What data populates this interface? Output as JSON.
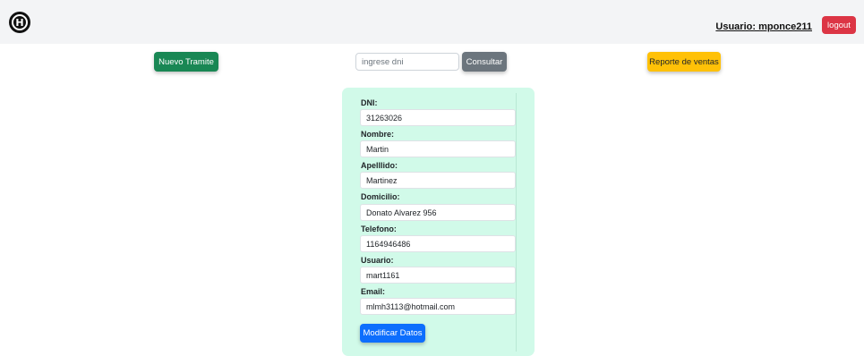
{
  "header": {
    "logo_letter": "H",
    "user_link": "Usuario: mponce211",
    "logout_label": "logout"
  },
  "toolbar": {
    "nuevo_tramite_label": "Nuevo Tramite",
    "search_placeholder": "ingrese dni",
    "search_value": "",
    "consultar_label": "Consultar",
    "reporte_label": "Reporte de ventas"
  },
  "form": {
    "fields": [
      {
        "label": "DNI:",
        "value": "31263026"
      },
      {
        "label": "Nombre:",
        "value": "Martin"
      },
      {
        "label": "Apelllido:",
        "value": "Martinez"
      },
      {
        "label": "Domicilio:",
        "value": "Donato Alvarez 956"
      },
      {
        "label": "Telefono:",
        "value": "1164946486"
      },
      {
        "label": "Usuario:",
        "value": "mart1161"
      },
      {
        "label": "Email:",
        "value": "mlmh3113@hotmail.com"
      }
    ],
    "submit_label": "Modificar Datos"
  },
  "colors": {
    "success": "#198754",
    "secondary": "#6c757d",
    "warning": "#ffc107",
    "danger": "#dc3545",
    "primary": "#0d6efd",
    "card_bg": "#d1fae9"
  }
}
